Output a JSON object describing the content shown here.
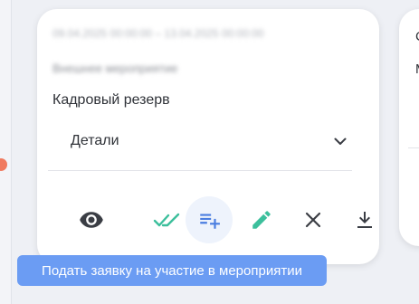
{
  "card": {
    "date_range": "09.04.2025 00:00:00 – 13.04.2025 00:00:00",
    "event_type": "Внешнее мероприятие",
    "category": "Кадровый резерв",
    "details_label": "Детали"
  },
  "actions": [
    {
      "name": "view",
      "icon": "eye-icon"
    },
    {
      "name": "approve",
      "icon": "double-check-icon"
    },
    {
      "name": "apply",
      "icon": "playlist-add-icon"
    },
    {
      "name": "edit",
      "icon": "pencil-icon"
    },
    {
      "name": "close",
      "icon": "close-icon"
    },
    {
      "name": "download",
      "icon": "download-icon"
    }
  ],
  "tooltip": {
    "text": "Подать заявку на участие в мероприятии"
  },
  "next_card": {
    "line1": "С",
    "line2": "М"
  },
  "colors": {
    "accent_green": "#3cbf9c",
    "accent_blue": "#4a7de0",
    "tooltip_bg": "#6b9cf3",
    "icon_dark": "#3a3d44",
    "notification": "#f07a5f"
  }
}
